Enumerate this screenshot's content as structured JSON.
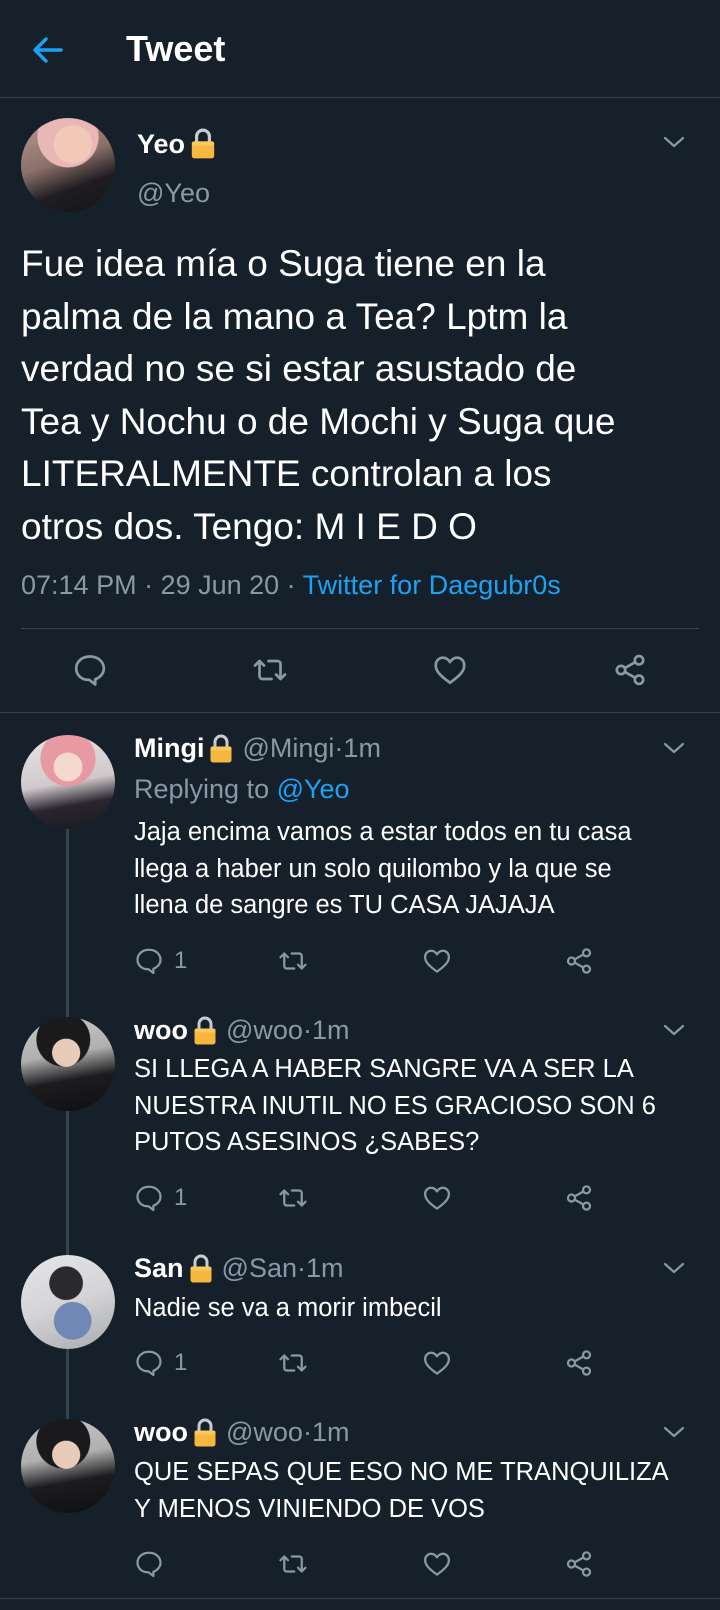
{
  "header": {
    "title": "Tweet",
    "back_icon": "arrow-left-icon",
    "accent": "#1da1f2"
  },
  "tweet": {
    "name": "Yeo",
    "handle": "@Yeo",
    "text": "Fue idea mía o Suga tiene en la\npalma de la mano a Tea? Lptm la\nverdad no se si estar asustado de\nTea y Nochu o de Mochi y Suga que\nLITERALMENTE controlan a los\notros dos. Tengo: M I E D O",
    "time": "07:14 PM · 29 Jun 20 · ",
    "client": "Twitter for Daegubr0s",
    "actions": [
      "reply-icon",
      "retweet-icon",
      "like-icon",
      "share-icon"
    ]
  },
  "replies": [
    {
      "name": "Mingi",
      "handle": "@Mingi",
      "time": "1m",
      "replying_label": "Replying to ",
      "replying_to": "@Yeo",
      "text": "Jaja encima vamos a estar todos en tu casa\nllega a haber un solo quilombo y la que se\nllena de sangre es TU CASA JAJAJA",
      "reply_count": "1"
    },
    {
      "name": "woo",
      "handle": "@woo",
      "time": "1m",
      "text": "SI LLEGA A HABER SANGRE VA A SER LA\nNUESTRA INUTIL NO ES GRACIOSO SON 6\nPUTOS ASESINOS ¿SABES?",
      "reply_count": "1"
    },
    {
      "name": "San",
      "handle": "@San",
      "time": "1m",
      "text": "Nadie se va a morir imbecil",
      "reply_count": "1"
    },
    {
      "name": "woo",
      "handle": "@woo",
      "time": "1m",
      "text": "QUE SEPAS QUE ESO NO ME TRANQUILIZA\nY MENOS VINIENDO DE VOS",
      "reply_count": ""
    }
  ],
  "separator": " · ",
  "colors": {
    "background": "#15202b",
    "secondary_text": "#8899a6",
    "link": "#1da1f2",
    "divider": "#38444d",
    "lock": "#f5b73d"
  }
}
